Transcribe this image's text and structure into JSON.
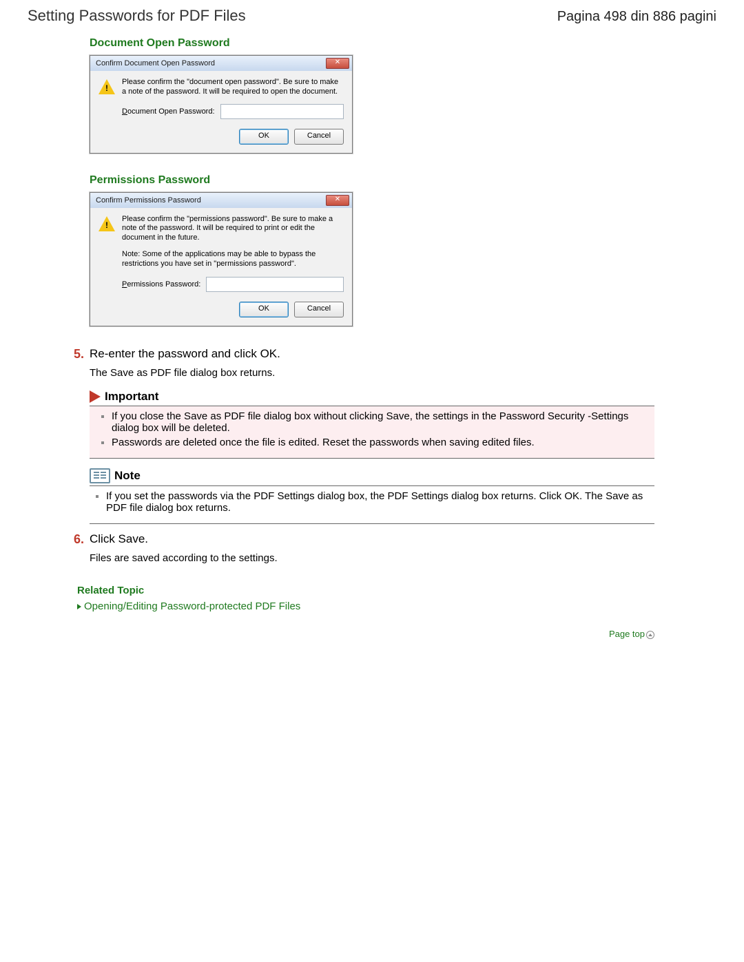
{
  "header": {
    "title": "Setting Passwords for PDF Files",
    "page_indicator": "Pagina 498 din 886 pagini"
  },
  "sections": {
    "doc_open_heading": "Document Open Password",
    "perm_heading": "Permissions Password"
  },
  "dialog1": {
    "title": "Confirm Document Open Password",
    "message": "Please confirm the \"document open password\". Be sure to make a note of the password. It will be required to open the document.",
    "field_letter": "D",
    "field_rest": "ocument Open Password:",
    "ok": "OK",
    "cancel": "Cancel"
  },
  "dialog2": {
    "title": "Confirm Permissions Password",
    "message": "Please confirm the \"permissions password\". Be sure to make a note of the password. It will be required to print or edit the document in the future.",
    "note": "Note: Some of the applications may be able to bypass the restrictions you have set in \"permissions password\".",
    "field_letter": "P",
    "field_rest": "ermissions Password:",
    "ok": "OK",
    "cancel": "Cancel"
  },
  "step5": {
    "num": "5.",
    "text": "Re-enter the password and click OK.",
    "sub": "The Save as PDF file dialog box returns."
  },
  "important": {
    "title": "Important",
    "items": [
      "If you close the Save as PDF file dialog box without clicking Save, the settings in the Password Security -Settings dialog box will be deleted.",
      "Passwords are deleted once the file is edited. Reset the passwords when saving edited files."
    ]
  },
  "note_box": {
    "title": "Note",
    "items": [
      "If you set the passwords via the PDF Settings dialog box, the PDF Settings dialog box returns. Click OK. The Save as PDF file dialog box returns."
    ]
  },
  "step6": {
    "num": "6.",
    "text": "Click Save.",
    "sub": "Files are saved according to the settings."
  },
  "related": {
    "heading": "Related Topic",
    "link": "Opening/Editing Password-protected PDF Files"
  },
  "page_top": "Page top"
}
